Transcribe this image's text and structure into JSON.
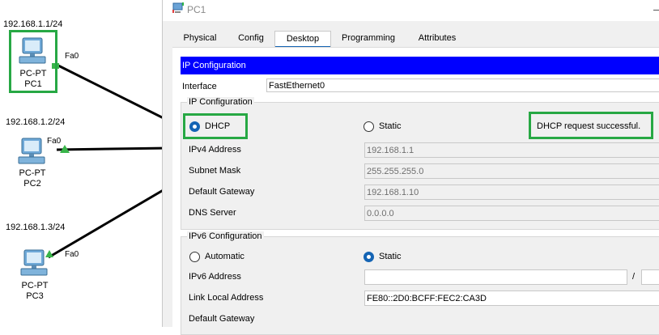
{
  "topology": {
    "devices": [
      {
        "ip": "192.168.1.1/24",
        "port": "Fa0",
        "type": "PC-PT",
        "name": "PC1"
      },
      {
        "ip": "192.168.1.2/24",
        "port": "Fa0",
        "type": "PC-PT",
        "name": "PC2"
      },
      {
        "ip": "192.168.1.3/24",
        "port": "Fa0",
        "type": "PC-PT",
        "name": "PC3"
      }
    ],
    "highlight_color": "#27a844",
    "link_up_color": "#39b54a"
  },
  "window": {
    "title": "PC1",
    "icon": "pc-icon",
    "tabs": [
      "Physical",
      "Config",
      "Desktop",
      "Programming",
      "Attributes"
    ],
    "active_tab": "Desktop",
    "ip_config": {
      "header": "IP Configuration",
      "header_color": "#0000ff",
      "interface_label": "Interface",
      "interface_value": "FastEthernet0",
      "ipv4_group": {
        "title": "IP Configuration",
        "dhcp_label": "DHCP",
        "static_label": "Static",
        "selected": "DHCP",
        "status": "DHCP request successful.",
        "fields": [
          {
            "label": "IPv4 Address",
            "value": "192.168.1.1"
          },
          {
            "label": "Subnet Mask",
            "value": "255.255.255.0"
          },
          {
            "label": "Default Gateway",
            "value": "192.168.1.10"
          },
          {
            "label": "DNS Server",
            "value": "0.0.0.0"
          }
        ]
      },
      "ipv6_group": {
        "title": "IPv6 Configuration",
        "automatic_label": "Automatic",
        "static_label": "Static",
        "selected": "Static",
        "ipv6_address_label": "IPv6 Address",
        "ipv6_address_value": "",
        "prefix_separator": "/",
        "link_local_label": "Link Local Address",
        "link_local_value": "FE80::2D0:BCFF:FEC2:CA3D",
        "default_gateway_label": "Default Gateway"
      }
    }
  }
}
